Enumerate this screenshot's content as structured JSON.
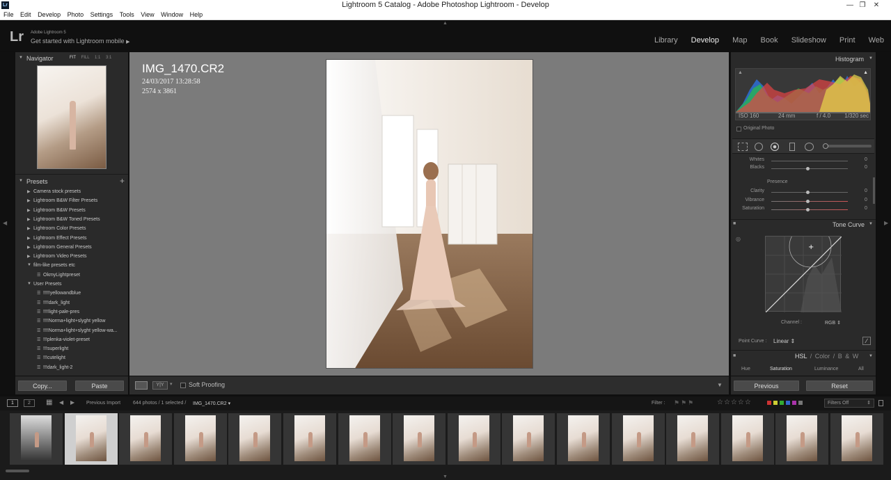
{
  "window": {
    "title": "Lightroom 5 Catalog - Adobe Photoshop Lightroom - Develop"
  },
  "menu": [
    "File",
    "Edit",
    "Develop",
    "Photo",
    "Settings",
    "Tools",
    "View",
    "Window",
    "Help"
  ],
  "identity": {
    "logo": "Lr",
    "version": "Adobe Lightroom 5",
    "mobile": "Get started with Lightroom mobile"
  },
  "modules": [
    "Library",
    "Develop",
    "Map",
    "Book",
    "Slideshow",
    "Print",
    "Web"
  ],
  "navigator": {
    "title": "Navigator",
    "zoom": [
      "FIT",
      "FILL",
      "1:1",
      "3:1"
    ]
  },
  "presets": {
    "title": "Presets",
    "items": [
      {
        "label": "Camera stock presets",
        "type": "folder"
      },
      {
        "label": "Lightroom B&W Filter Presets",
        "type": "folder"
      },
      {
        "label": "Lightroom B&W Presets",
        "type": "folder"
      },
      {
        "label": "Lightroom B&W Toned Presets",
        "type": "folder"
      },
      {
        "label": "Lightroom Color Presets",
        "type": "folder"
      },
      {
        "label": "Lightroom Effect Presets",
        "type": "folder"
      },
      {
        "label": "Lightroom General Presets",
        "type": "folder"
      },
      {
        "label": "Lightroom Video Presets",
        "type": "folder"
      },
      {
        "label": "film-like presets etc",
        "type": "folder-open"
      },
      {
        "label": "OkmyLightpreset",
        "type": "preset-sub"
      },
      {
        "label": "User Presets",
        "type": "folder-open"
      },
      {
        "label": "!!!!!yellowandblue",
        "type": "preset"
      },
      {
        "label": "!!!!dark_light",
        "type": "preset"
      },
      {
        "label": "!!!!light-pale-pres",
        "type": "preset"
      },
      {
        "label": "!!!!Norma+light+slyght yellow",
        "type": "preset"
      },
      {
        "label": "!!!!Norma+light+slyght yellow-wa...",
        "type": "preset"
      },
      {
        "label": "!!!plenka-violet-preset",
        "type": "preset"
      },
      {
        "label": "!!!superlight",
        "type": "preset"
      },
      {
        "label": "!!!cutelight",
        "type": "preset"
      },
      {
        "label": "!!!dark_light-2",
        "type": "preset"
      }
    ]
  },
  "left_buttons": {
    "copy": "Copy...",
    "paste": "Paste"
  },
  "photo_info": {
    "filename": "IMG_1470.CR2",
    "datetime": "24/03/2017 13:28:58",
    "dimensions": "2574 x 3861"
  },
  "toolbar": {
    "soft_proofing": "Soft Proofing"
  },
  "histogram": {
    "title": "Histogram",
    "iso": "ISO 160",
    "focal": "24 mm",
    "aperture": "f / 4.0",
    "shutter": "1/320 sec",
    "original_photo": "Original Photo"
  },
  "basic": {
    "whites": "Whites",
    "blacks": "Blacks",
    "presence": "Presence",
    "sliders": [
      {
        "label": "Clarity",
        "value": "0"
      },
      {
        "label": "Vibrance",
        "value": "0"
      },
      {
        "label": "Saturation",
        "value": "0"
      }
    ],
    "whites_value": "0",
    "blacks_value": "0"
  },
  "tone_curve": {
    "title": "Tone Curve",
    "channel_label": "Channel :",
    "channel": "RGB",
    "point_curve_label": "Point Curve :",
    "point_curve": "Linear"
  },
  "hsl": {
    "title_parts": [
      "HSL",
      "/",
      "Color",
      "/",
      "B & W"
    ],
    "tabs": [
      "Hue",
      "Saturation",
      "Luminance",
      "All"
    ]
  },
  "right_buttons": {
    "previous": "Previous",
    "reset": "Reset"
  },
  "filmbar": {
    "screen1": "1",
    "screen2": "2",
    "source": "Previous Import",
    "count": "644 photos / 1 selected /",
    "current": "IMG_1470.CR2",
    "filter_label": "Filter :",
    "filters_off": "Filters Off"
  },
  "filmstrip": {
    "count": 16,
    "selected_index": 1
  }
}
